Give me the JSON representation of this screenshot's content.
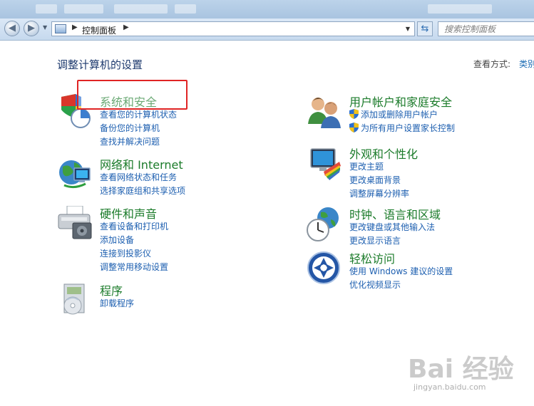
{
  "nav": {
    "address_segment": "控制面板",
    "search_placeholder": "搜索控制面板"
  },
  "page": {
    "title": "调整计算机的设置",
    "view_by_label": "查看方式:",
    "view_by_value": "类别"
  },
  "categories": {
    "system": {
      "title": "系统和安全",
      "links": [
        "查看您的计算机状态",
        "备份您的计算机",
        "查找并解决问题"
      ]
    },
    "network": {
      "title": "网络和 Internet",
      "links": [
        "查看网络状态和任务",
        "选择家庭组和共享选项"
      ]
    },
    "hardware": {
      "title": "硬件和声音",
      "links": [
        "查看设备和打印机",
        "添加设备",
        "连接到投影仪",
        "调整常用移动设置"
      ]
    },
    "programs": {
      "title": "程序",
      "links": [
        "卸载程序"
      ]
    },
    "users": {
      "title": "用户帐户和家庭安全",
      "links": [
        "添加或删除用户帐户",
        "为所有用户设置家长控制"
      ]
    },
    "appearance": {
      "title": "外观和个性化",
      "links": [
        "更改主题",
        "更改桌面背景",
        "调整屏幕分辨率"
      ]
    },
    "clock": {
      "title": "时钟、语言和区域",
      "links": [
        "更改键盘或其他输入法",
        "更改显示语言"
      ]
    },
    "ease": {
      "title": "轻松访问",
      "links": [
        "使用 Windows 建议的设置",
        "优化视频显示"
      ]
    }
  },
  "watermark": {
    "main": "Bai 经验",
    "sub": "jingyan.baidu.com"
  },
  "colors": {
    "category_title": "#1b7b2a",
    "link": "#1d5fb0",
    "highlight_border": "#e02424"
  }
}
